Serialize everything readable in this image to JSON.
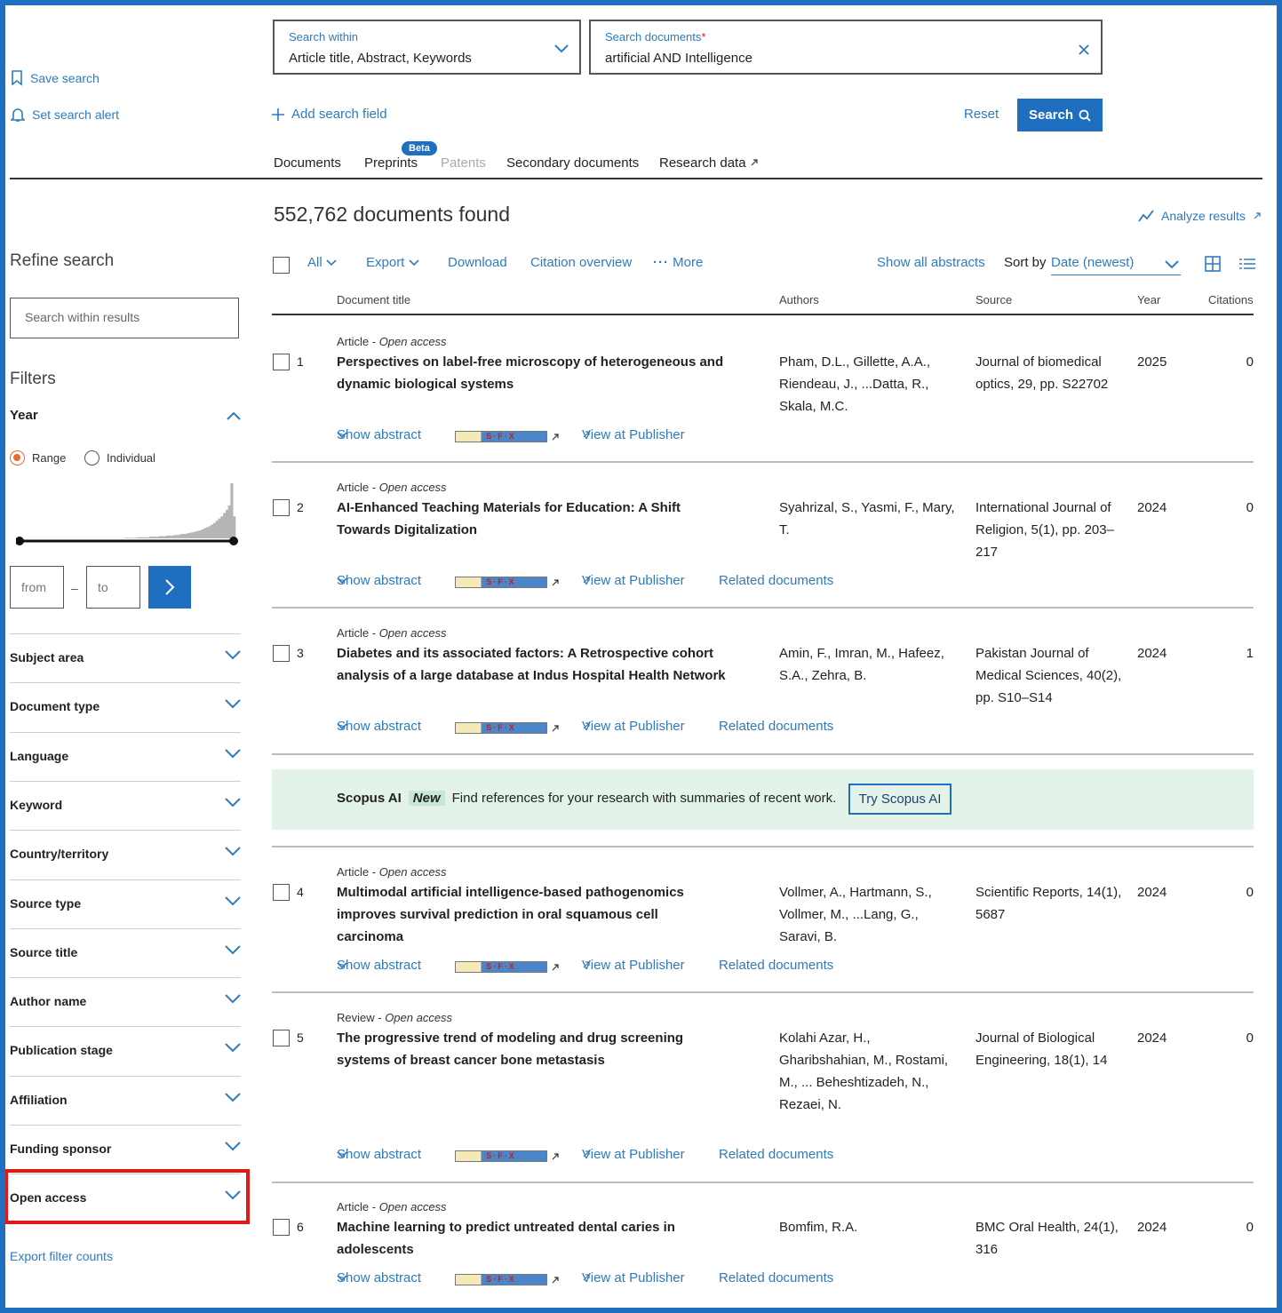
{
  "sidebar": {
    "save_search": "Save search",
    "set_alert": "Set search alert",
    "refine_title": "Refine search",
    "search_within_placeholder": "Search within results",
    "filters_title": "Filters",
    "year_label": "Year",
    "range_label": "Range",
    "individual_label": "Individual",
    "from_placeholder": "from",
    "dash": "–",
    "to_placeholder": "to",
    "facets": [
      "Subject area",
      "Document type",
      "Language",
      "Keyword",
      "Country/territory",
      "Source type",
      "Source title",
      "Author name",
      "Publication stage",
      "Affiliation",
      "Funding sponsor",
      "Open access"
    ],
    "export_filter_counts": "Export filter counts",
    "histogram_values": [
      0,
      0,
      0,
      0,
      0,
      0,
      0,
      0,
      0,
      0,
      0,
      0,
      0,
      0,
      0,
      0,
      0,
      0,
      0,
      0,
      0,
      0,
      0,
      0,
      0,
      0,
      0,
      0,
      0,
      0,
      0,
      0,
      0,
      0,
      0,
      0,
      0,
      0,
      0,
      0,
      0,
      0,
      0,
      1,
      1,
      1,
      1,
      1,
      2,
      2,
      2,
      2,
      2,
      3,
      3,
      3,
      3,
      4,
      4,
      4,
      5,
      5,
      5,
      6,
      6,
      7,
      8,
      8,
      9,
      10,
      11,
      12,
      13,
      14,
      16,
      18,
      20,
      22,
      25,
      28,
      32,
      36,
      40,
      46,
      52,
      60,
      100,
      40
    ]
  },
  "search": {
    "within_label": "Search within",
    "within_value": "Article title, Abstract, Keywords",
    "docs_label": "Search documents",
    "required_mark": "*",
    "docs_value": "artificial AND Intelligence",
    "add_field": "Add search field",
    "reset": "Reset",
    "search_btn": "Search"
  },
  "tabs": {
    "documents": "Documents",
    "preprints": "Preprints",
    "beta": "Beta",
    "patents": "Patents",
    "secondary": "Secondary documents",
    "research_data": "Research data"
  },
  "results": {
    "count_text": "552,762 documents found",
    "analyze": "Analyze results",
    "all": "All",
    "export": "Export",
    "download": "Download",
    "citation_overview": "Citation overview",
    "more": "More",
    "show_all_abstracts": "Show all abstracts",
    "sort_by": "Sort by",
    "sort_value": "Date (newest)",
    "columns": {
      "title": "Document title",
      "authors": "Authors",
      "source": "Source",
      "year": "Year",
      "citations": "Citations"
    },
    "show_abstract": "Show abstract",
    "sfx_label": "S·F·X",
    "view_publisher": "View at Publisher",
    "related": "Related documents",
    "items": [
      {
        "num": "1",
        "type": "Article",
        "access": "Open access",
        "title": "Perspectives on label-free microscopy of heterogeneous and dynamic biological systems",
        "authors": "Pham, D.L., Gillette, A.A., Riendeau, J., ...Datta, R., Skala, M.C.",
        "source": "Journal of biomedical optics, 29, pp. S22702",
        "year": "2025",
        "cites": "0",
        "related": false
      },
      {
        "num": "2",
        "type": "Article",
        "access": "Open access",
        "title": "AI-Enhanced Teaching Materials for Education: A Shift Towards Digitalization",
        "authors": "Syahrizal, S., Yasmi, F., Mary, T.",
        "source": "International Journal of Religion, 5(1), pp. 203–217",
        "year": "2024",
        "cites": "0",
        "related": true
      },
      {
        "num": "3",
        "type": "Article",
        "access": "Open access",
        "title": "Diabetes and its associated factors: A Retrospective cohort analysis of a large database at Indus Hospital Health Network",
        "authors": "Amin, F., Imran, M., Hafeez, S.A., Zehra, B.",
        "source": "Pakistan Journal of Medical Sciences, 40(2), pp. S10–S14",
        "year": "2024",
        "cites": "1",
        "related": true
      },
      {
        "num": "4",
        "type": "Article",
        "access": "Open access",
        "title": "Multimodal artificial intelligence-based pathogenomics improves survival prediction in oral squamous cell carcinoma",
        "authors": "Vollmer, A., Hartmann, S., Vollmer, M., ...Lang, G., Saravi, B.",
        "source": "Scientific Reports, 14(1), 5687",
        "year": "2024",
        "cites": "0",
        "related": true
      },
      {
        "num": "5",
        "type": "Review",
        "access": "Open access",
        "title": "The progressive trend of modeling and drug screening systems of breast cancer bone metastasis",
        "authors": "Kolahi Azar, H., Gharibshahian, M., Rostami, M., ... Beheshtizadeh, N., Rezaei, N.",
        "source": "Journal of Biological Engineering, 18(1), 14",
        "year": "2024",
        "cites": "0",
        "related": true
      },
      {
        "num": "6",
        "type": "Article",
        "access": "Open access",
        "title": "Machine learning to predict untreated dental caries in adolescents",
        "authors": "Bomfim, R.A.",
        "source": "BMC Oral Health, 24(1), 316",
        "year": "2024",
        "cites": "0",
        "related": true
      }
    ]
  },
  "ai_banner": {
    "name": "Scopus AI",
    "new": "New",
    "text": "Find references for your research with summaries of recent work.",
    "button": "Try Scopus AI"
  },
  "colors": {
    "accent": "#1f6fc0",
    "highlight": "#e01818",
    "banner": "#e3f3ea",
    "radio": "#e8692f"
  }
}
